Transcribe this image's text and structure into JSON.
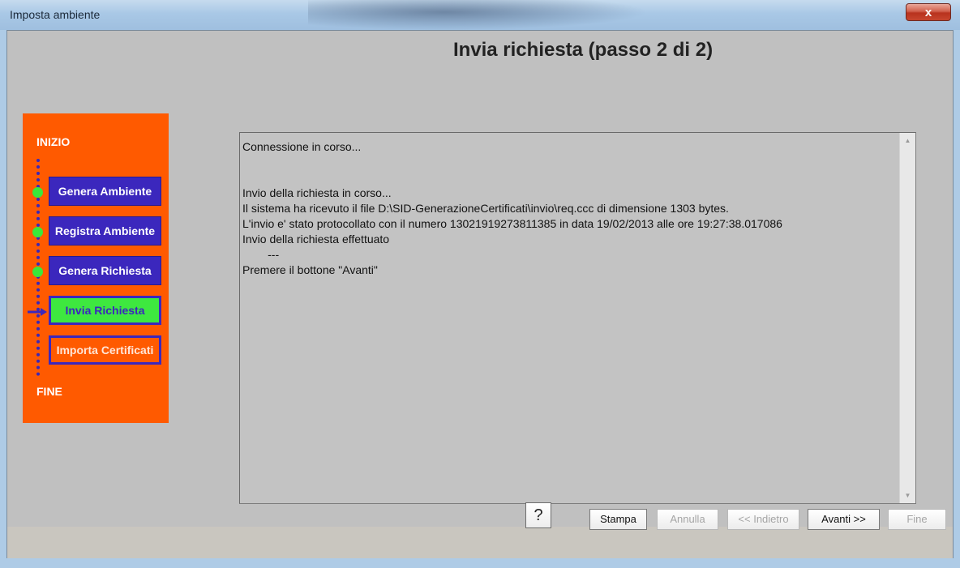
{
  "window": {
    "title": "Imposta ambiente",
    "close_label": "x"
  },
  "page": {
    "heading": "Invia richiesta (passo 2 di 2)"
  },
  "wizard": {
    "start_label": "INIZIO",
    "end_label": "FINE",
    "steps": [
      {
        "label": "Genera Ambiente",
        "state": "completed"
      },
      {
        "label": "Registra Ambiente",
        "state": "completed"
      },
      {
        "label": "Genera Richiesta",
        "state": "completed"
      },
      {
        "label": "Invia Richiesta",
        "state": "current"
      },
      {
        "label": "Importa Certificati",
        "state": "pending"
      }
    ]
  },
  "log": {
    "lines": [
      "Connessione in corso...",
      "",
      "",
      "Invio della richiesta in corso...",
      "Il sistema ha ricevuto il file D:\\SID-GenerazioneCertificati\\invio\\req.ccc di dimensione 1303 bytes.",
      "L'invio e' stato protocollato con il numero 13021919273811385 in data 19/02/2013 alle ore 19:27:38.017086",
      "Invio della richiesta effettuato",
      "        ---",
      "Premere il bottone \"Avanti\""
    ]
  },
  "footer": {
    "help_label": "?",
    "buttons": [
      {
        "label": "Stampa",
        "enabled": true
      },
      {
        "label": "Annulla",
        "enabled": false
      },
      {
        "label": "<< Indietro",
        "enabled": false
      },
      {
        "label": "Avanti >>",
        "enabled": true
      },
      {
        "label": "Fine",
        "enabled": false
      }
    ]
  },
  "colors": {
    "wizard_panel": "#ff5a00",
    "step_done": "#3b27bd",
    "step_current": "#3ee83f",
    "step_dot": "#39e83a"
  }
}
